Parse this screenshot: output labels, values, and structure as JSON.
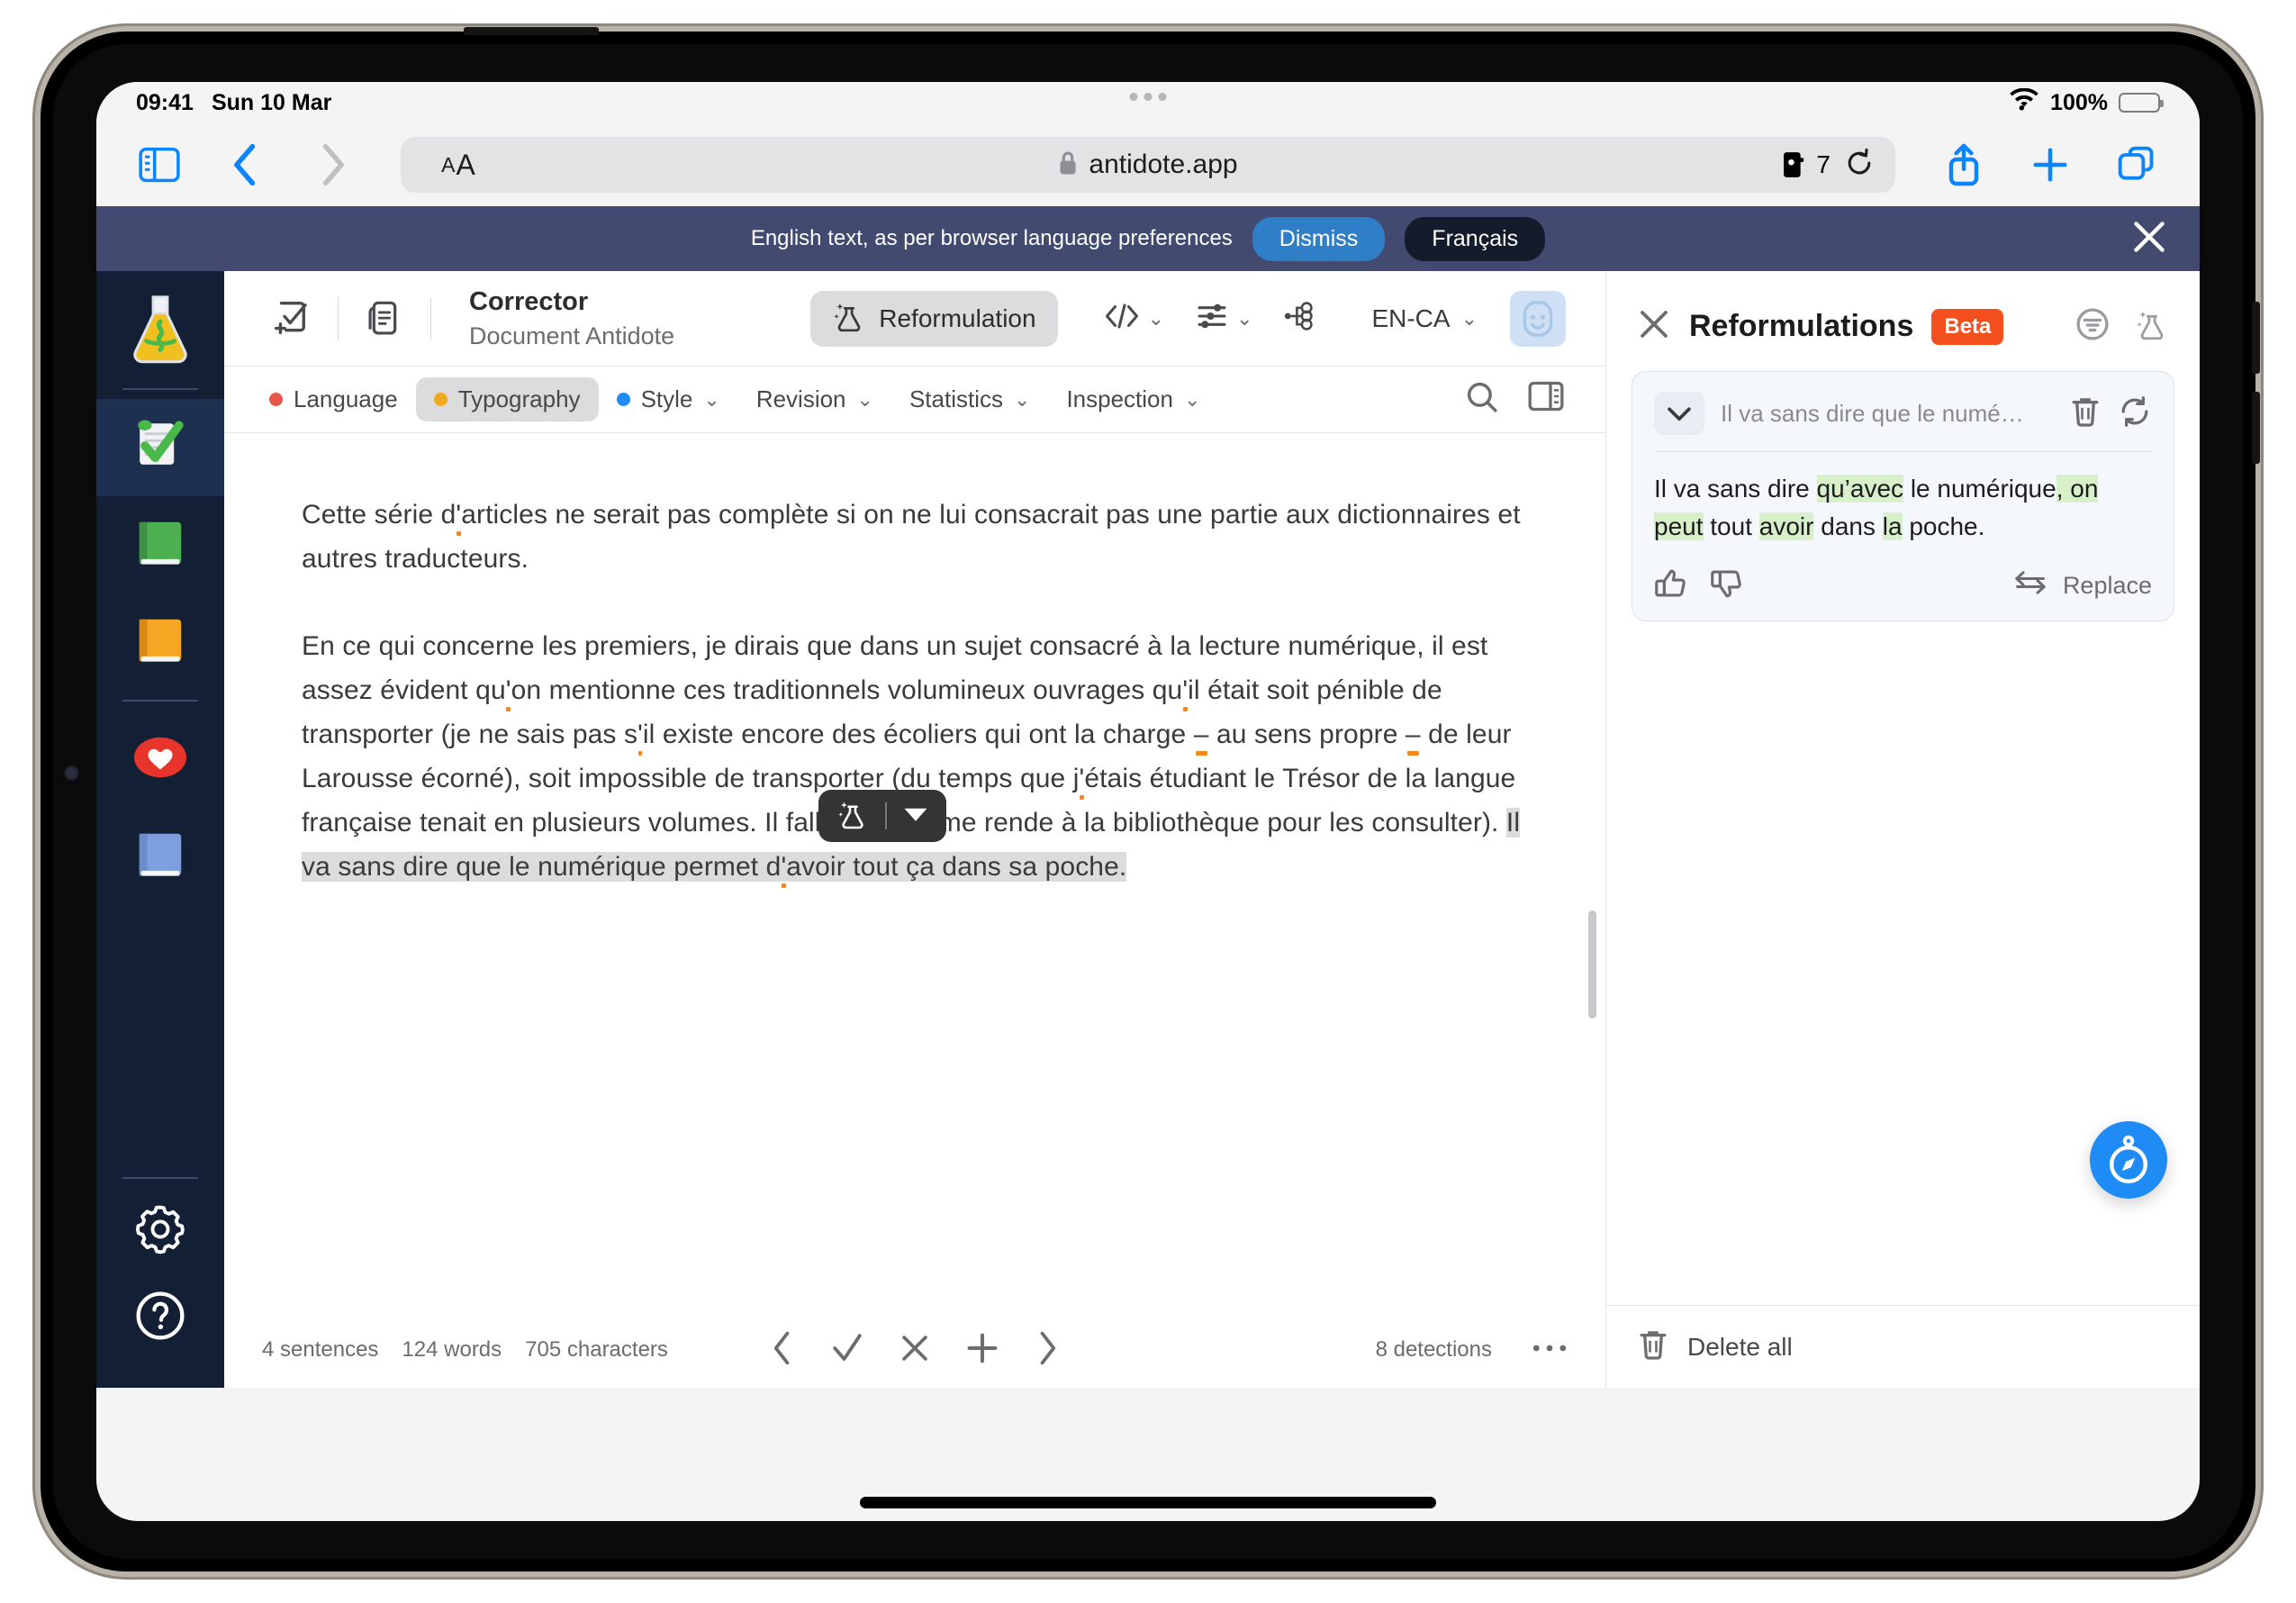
{
  "status_bar": {
    "time": "09:41",
    "date": "Sun 10 Mar",
    "battery_percent": "100%",
    "wifi_icon": "wifi-icon",
    "battery_icon": "battery-icon"
  },
  "safari": {
    "sidebar_icon": "sidebar-toggle-icon",
    "back_icon": "back-chevron-icon",
    "forward_icon": "forward-chevron-icon",
    "text_size_small": "A",
    "text_size_large": "A",
    "lock_icon": "lock-icon",
    "url": "antidote.app",
    "extension_count": "7",
    "extension_icon": "puzzle-extension-icon",
    "reload_icon": "reload-icon",
    "share_icon": "share-icon",
    "new_tab_icon": "plus-icon",
    "tabs_icon": "tab-overview-icon"
  },
  "banner": {
    "message": "English text, as per browser language preferences",
    "dismiss_label": "Dismiss",
    "language_label": "Français",
    "close_icon": "close-icon",
    "background_color": "#424a70",
    "dismiss_color": "#2f7fc8"
  },
  "sidebar": {
    "items": [
      {
        "name": "antidote-logo",
        "icon": "flask-icon",
        "active": false
      },
      {
        "name": "corrector",
        "icon": "document-check-icon",
        "active": true
      },
      {
        "name": "dictionaries",
        "icon": "green-book-icon",
        "active": false
      },
      {
        "name": "guides",
        "icon": "orange-book-icon",
        "active": false
      },
      {
        "name": "favorites",
        "icon": "heart-icon",
        "active": false
      },
      {
        "name": "blue-book",
        "icon": "blue-book-icon",
        "active": false
      }
    ],
    "bottom_items": [
      {
        "name": "settings",
        "icon": "gear-icon"
      },
      {
        "name": "help",
        "icon": "question-circle-icon"
      }
    ]
  },
  "app_toolbar": {
    "new_doc_icon": "new-document-check-icon",
    "documents_icon": "documents-stack-icon",
    "title": "Corrector",
    "subtitle": "Document Antidote",
    "reformulation_label": "Reformulation",
    "reformulation_icon": "flask-sparkle-icon",
    "code_icon": "code-brackets-icon",
    "filters_icon": "sliders-icon",
    "tree_icon": "node-tree-icon",
    "language": "EN-CA",
    "avatar_icon": "avatar-icon",
    "chevron_icon": "chevron-down-icon"
  },
  "tabs": [
    {
      "label": "Language",
      "dot": "#e8564a",
      "has_chevron": false,
      "selected": false
    },
    {
      "label": "Typography",
      "dot": "#f0a91e",
      "has_chevron": false,
      "selected": true
    },
    {
      "label": "Style",
      "dot": "#1f8cf5",
      "has_chevron": true,
      "selected": false
    },
    {
      "label": "Revision",
      "dot": "",
      "has_chevron": true,
      "selected": false
    },
    {
      "label": "Statistics",
      "dot": "",
      "has_chevron": true,
      "selected": false
    },
    {
      "label": "Inspection",
      "dot": "",
      "has_chevron": true,
      "selected": false
    }
  ],
  "tabbar_right": {
    "search_icon": "search-icon",
    "panel_icon": "panel-toggle-icon"
  },
  "document": {
    "p1_a": "Cette série d",
    "p1_apos": "'",
    "p1_b": "articles ne serait pas complète si on ne lui consacrait pas une partie aux dictionnaires et autres traducteurs.",
    "p2_1": "En ce qui concerne les premiers, je dirais que dans un sujet consacré à la lecture numérique, il est assez évident qu",
    "p2_2": "on mentionne ces traditionnels volumineux ouvrages qu",
    "p2_3": "il était soit pénible de transporter (je ne sais pas s",
    "p2_4": "il existe encore des écoliers qui ont la charge ",
    "p2_dash1": "–",
    "p2_5": " au sens propre ",
    "p2_dash2": "–",
    "p2_6": " de leur Larousse écorné), soit impossible de transporter (du temps que j",
    "p2_7": "étais étudiant le Trésor de la langue française tenait en plusieurs volumes. Il fallait que je me rende à la bibliothèque pour les consulter). ",
    "sel_1": "Il va sans dire que le numérique permet d",
    "sel_apos": "'",
    "sel_2": "avoir tout ça dans sa poche.",
    "marker_color": "#f08a1e",
    "selection_color": "#dcdcdc"
  },
  "float_toolbar": {
    "flask_icon": "flask-sparkle-icon",
    "dropdown_icon": "caret-down-icon"
  },
  "app_status": {
    "sentences": "4 sentences",
    "words": "124 words",
    "characters": "705 characters",
    "prev_icon": "chevron-left-icon",
    "accept_icon": "checkmark-icon",
    "reject_icon": "x-icon",
    "add_icon": "plus-icon",
    "next_icon": "chevron-right-icon",
    "detections": "8 detections",
    "more_icon": "ellipsis-icon"
  },
  "right_panel": {
    "close_icon": "close-icon",
    "title": "Reformulations",
    "badge": "Beta",
    "badge_color": "#f4501e",
    "filter_icon": "filter-icon",
    "flask_icon": "flask-sparkle-icon",
    "card": {
      "chevron_icon": "chevron-down-icon",
      "original_truncated": "Il va sans dire que le numé…",
      "delete_icon": "trash-icon",
      "refresh_icon": "refresh-icon",
      "result_1": "Il va sans dire ",
      "result_hl1": "qu’avec",
      "result_2": " le numérique",
      "result_hl2": ", on peut",
      "result_3": " tout ",
      "result_hl3": "avoir",
      "result_4": " dans ",
      "result_hl4": "la",
      "result_5": " poche.",
      "highlight_color": "#d7f0ca",
      "thumbs_up_icon": "thumbs-up-icon",
      "thumbs_down_icon": "thumbs-down-icon",
      "replace_icon": "swap-arrows-icon",
      "replace_label": "Replace"
    },
    "fab_icon": "safari-compass-icon",
    "fab_color": "#1f8cf5",
    "delete_all_icon": "trash-icon",
    "delete_all_label": "Delete all"
  }
}
